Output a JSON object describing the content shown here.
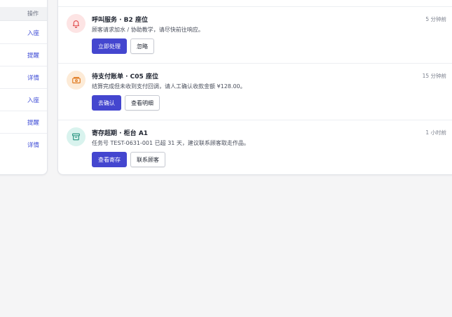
{
  "table": {
    "header_action": "操作",
    "rows": [
      {
        "action": "入座"
      },
      {
        "action": "提醒"
      },
      {
        "action": "详情"
      },
      {
        "action": "入座"
      },
      {
        "action": "提醒"
      },
      {
        "action": "详情"
      }
    ]
  },
  "notifications": [
    {
      "title": "呼叫服务 · B2 座位",
      "description": "顾客请求加水 / 协助教学，请尽快前往响应。",
      "time": "5 分钟前",
      "icon": "bell-icon",
      "icon_bg": "#fde4e4",
      "icon_color": "#e04848",
      "primary_label": "立即处理",
      "secondary_label": "忽略"
    },
    {
      "title": "待支付账单 · C05 座位",
      "description": "结算完成但未收到支付回调，请人工确认收款金额 ¥128.00。",
      "time": "15 分钟前",
      "icon": "cash-icon",
      "icon_bg": "#fdebd7",
      "icon_color": "#e07a1f",
      "primary_label": "去确认",
      "secondary_label": "查看明细"
    },
    {
      "title": "寄存超期 · 柜台 A1",
      "description": "任务号 TEST-0631-001 已超 31 天，建议联系顾客取走作品。",
      "time": "1 小时前",
      "icon": "archive-icon",
      "icon_bg": "#d9f3ee",
      "icon_color": "#1f8f7a",
      "primary_label": "查看寄存",
      "secondary_label": "联系顾客"
    }
  ],
  "colors": {
    "accent": "#4446cf",
    "link": "#3d4bd6"
  }
}
